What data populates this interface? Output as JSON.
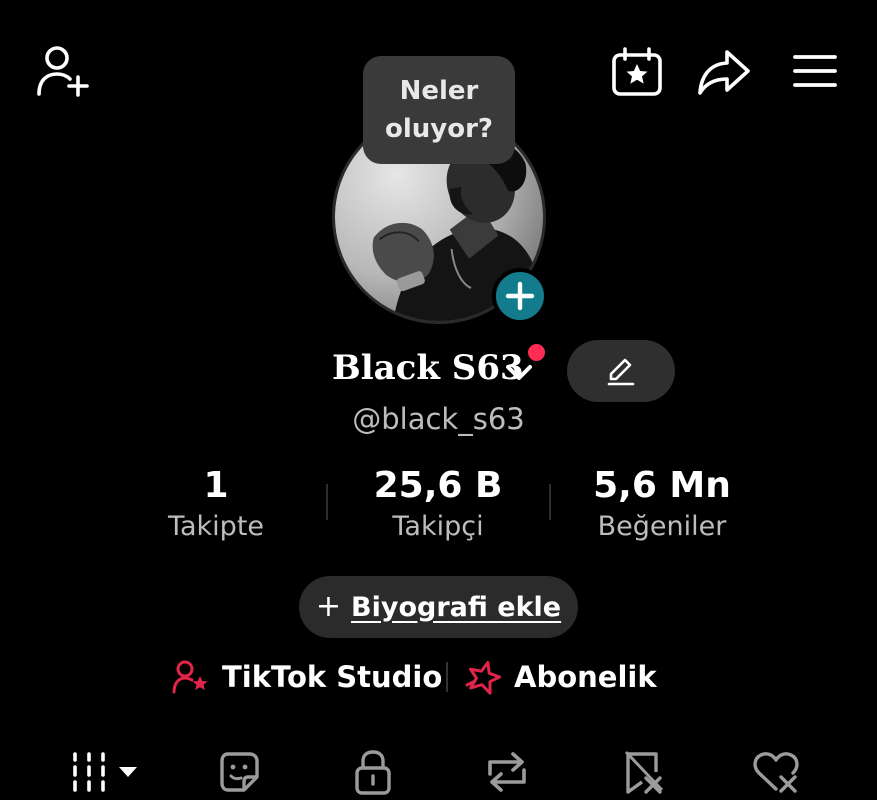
{
  "tooltip": {
    "line1": "Neler",
    "line2": "oluyor?"
  },
  "profile": {
    "display_name": "Black S63",
    "username": "@black_s63"
  },
  "stats": [
    {
      "value": "1",
      "label": "Takipte"
    },
    {
      "value": "25,6 B",
      "label": "Takipçi"
    },
    {
      "value": "5,6 Mn",
      "label": "Beğeniler"
    }
  ],
  "bio_button": {
    "icon": "+",
    "label": "Biyografi ekle"
  },
  "links": {
    "studio": "TikTok Studio",
    "subscription": "Abonelik"
  },
  "colors": {
    "background": "#000000",
    "accent_red": "#fe2c55",
    "avatar_plus": "#127c8c",
    "link_icon_red": "#e0244a"
  },
  "icons": {
    "top_left": "add-friend-icon",
    "top_right": [
      "calendar-star-icon",
      "share-icon",
      "hamburger-menu-icon"
    ],
    "tabs": [
      "videos-grid-icon",
      "stickers-icon",
      "lock-icon",
      "repost-icon",
      "favorites-icon",
      "liked-icon"
    ]
  }
}
